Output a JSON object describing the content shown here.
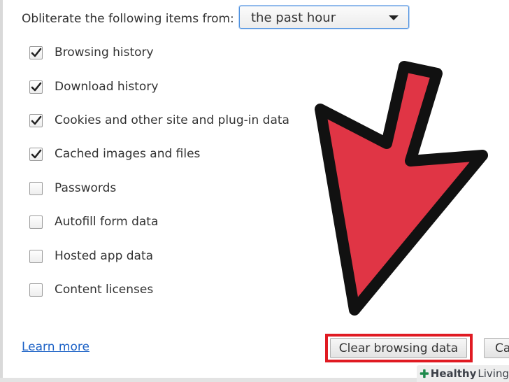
{
  "header": {
    "label": "Obliterate the following items from:",
    "time_range": "the past hour"
  },
  "checkboxes": [
    {
      "label": "Browsing history",
      "checked": true
    },
    {
      "label": "Download history",
      "checked": true
    },
    {
      "label": "Cookies and other site and plug-in data",
      "checked": true
    },
    {
      "label": "Cached images and files",
      "checked": true
    },
    {
      "label": "Passwords",
      "checked": false
    },
    {
      "label": "Autofill form data",
      "checked": false
    },
    {
      "label": "Hosted app data",
      "checked": false
    },
    {
      "label": "Content licenses",
      "checked": false
    }
  ],
  "footer": {
    "learn_more": "Learn more",
    "clear_button": "Clear browsing data",
    "cancel_button": "Ca"
  },
  "watermark": {
    "brand_bold": "Healthy",
    "brand_light": "Living"
  },
  "colors": {
    "arrow_fill": "#e03545",
    "highlight_border": "#e01a22",
    "link": "#1b61c6",
    "watermark_icon": "#1f8a4c"
  },
  "icons": {
    "checkmark": "checkmark-icon",
    "dropdown": "chevron-down-icon",
    "arrow": "red-arrow-annotation",
    "watermark": "plus-leaf-icon"
  }
}
